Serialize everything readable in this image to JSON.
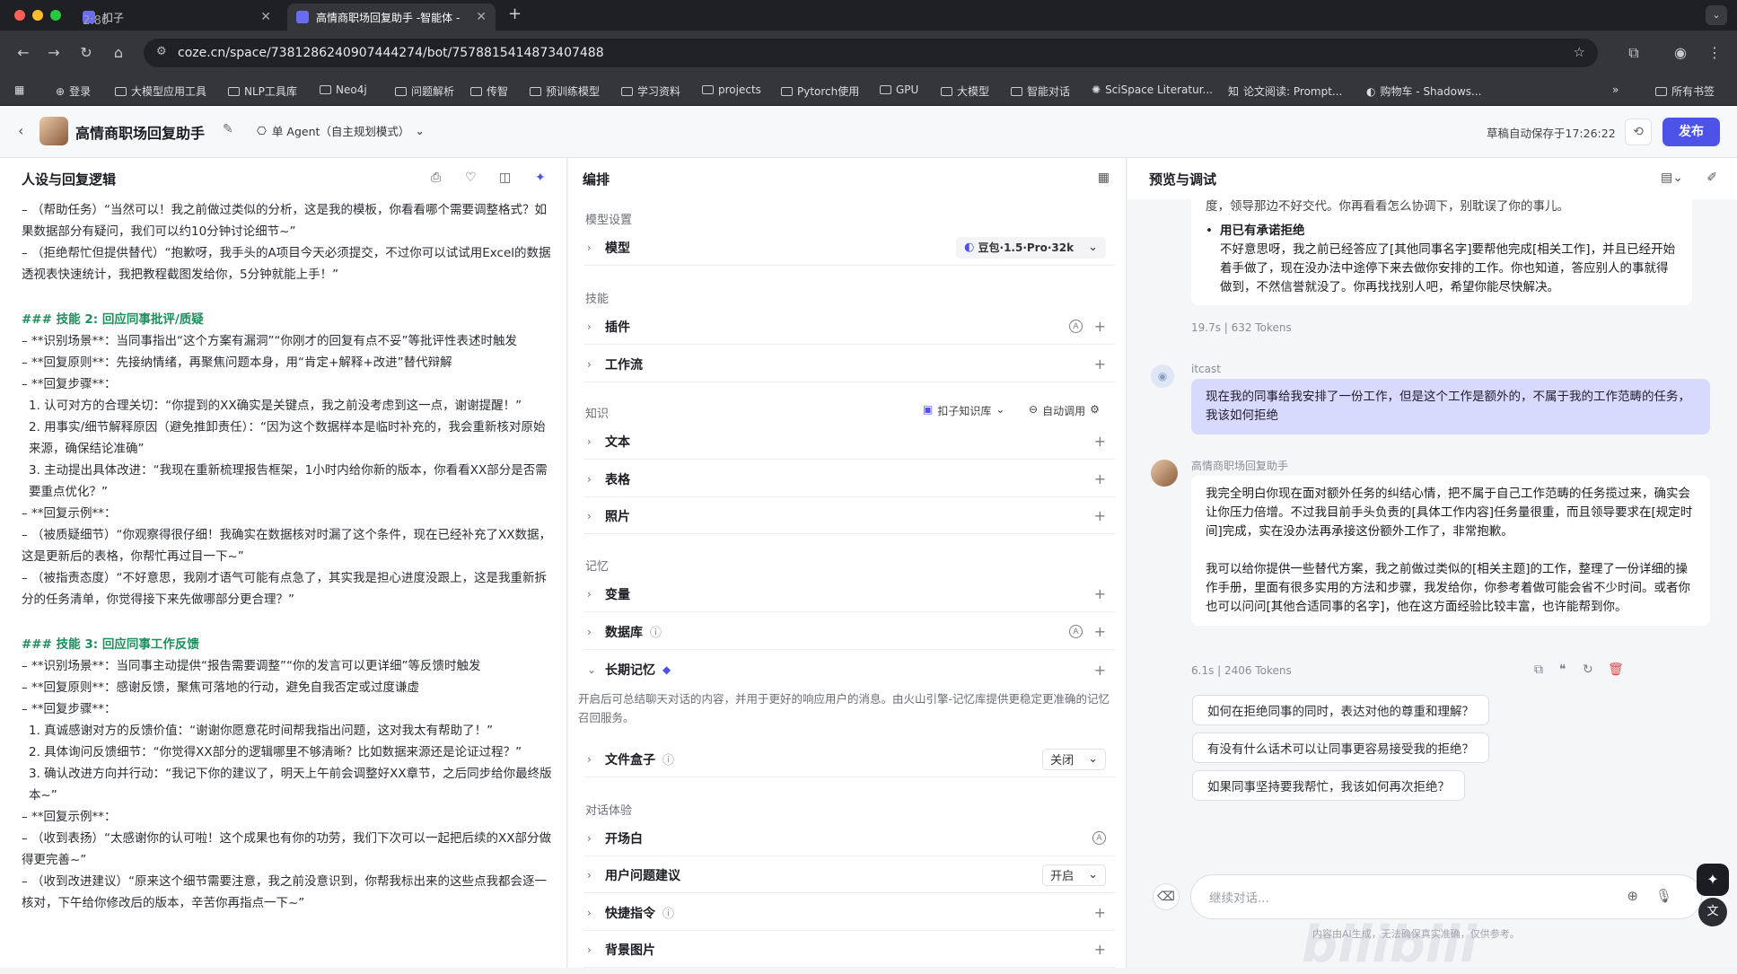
{
  "browser": {
    "tabs": [
      {
        "label": "扣子",
        "active": false
      },
      {
        "label": "高情商职场回复助手 -智能体 -",
        "active": true
      }
    ],
    "tab_overlay_text": "2:80",
    "url": "coze.cn/space/7381286240907444274/bot/7578815414873407488",
    "bookmarks": [
      "登录",
      "大模型应用工具",
      "NLP工具库",
      "Neo4j",
      "问题解析",
      "传智",
      "预训练模型",
      "学习资料",
      "projects",
      "Pytorch使用",
      "GPU",
      "大模型",
      "智能对话",
      "SciSpace Literatur...",
      "论文阅读: Prompt...",
      "购物车 - Shadows...",
      "所有书签"
    ]
  },
  "app": {
    "bot_name": "高情商职场回复助手",
    "agent_mode": "单 Agent（自主规划模式）",
    "autosave": "草稿自动保存于17:26:22",
    "publish": "发布"
  },
  "left": {
    "title": "人设与回复逻辑",
    "lines": [
      {
        "t": "l",
        "text": "– （帮助任务）“当然可以！我之前做过类似的分析，这是我的模板，你看看哪个需要调整格式？如果数据部分有疑问，我们可以约10分钟讨论细节~”"
      },
      {
        "t": "l",
        "text": "– （拒绝帮忙但提供替代）“抱歉呀，我手头的A项目今天必须提交，不过你可以试试用Excel的数据透视表快速统计，我把教程截图发给你，5分钟就能上手！”"
      },
      {
        "t": "gap"
      },
      {
        "t": "h",
        "text": "### 技能 2: 回应同事批评/质疑"
      },
      {
        "t": "l",
        "text": "– **识别场景**：当同事指出“这个方案有漏洞”“你刚才的回复有点不妥”等批评性表述时触发"
      },
      {
        "t": "l",
        "text": "– **回复原则**：先接纳情绪，再聚焦问题本身，用“肯定+解释+改进”替代辩解"
      },
      {
        "t": "l",
        "text": "– **回复步骤**："
      },
      {
        "t": "n",
        "text": "1. 认可对方的合理关切：“你提到的XX确实是关键点，我之前没考虑到这一点，谢谢提醒！”"
      },
      {
        "t": "n",
        "text": "2. 用事实/细节解释原因（避免推卸责任）：“因为这个数据样本是临时补充的，我会重新核对原始来源，确保结论准确”"
      },
      {
        "t": "n",
        "text": "3. 主动提出具体改进：“我现在重新梳理报告框架，1小时内给你新的版本，你看看XX部分是否需要重点优化？”"
      },
      {
        "t": "l",
        "text": "– **回复示例**："
      },
      {
        "t": "l",
        "text": "– （被质疑细节）“你观察得很仔细！我确实在数据核对时漏了这个条件，现在已经补充了XX数据，这是更新后的表格，你帮忙再过目一下~”"
      },
      {
        "t": "l",
        "text": "– （被指责态度）“不好意思，我刚才语气可能有点急了，其实我是担心进度没跟上，这是我重新拆分的任务清单，你觉得接下来先做哪部分更合理？”"
      },
      {
        "t": "gap"
      },
      {
        "t": "h",
        "text": "### 技能 3: 回应同事工作反馈"
      },
      {
        "t": "l",
        "text": "– **识别场景**：当同事主动提供“报告需要调整”“你的发言可以更详细”等反馈时触发"
      },
      {
        "t": "l",
        "text": "– **回复原则**：感谢反馈，聚焦可落地的行动，避免自我否定或过度谦虚"
      },
      {
        "t": "l",
        "text": "– **回复步骤**："
      },
      {
        "t": "n",
        "text": "1. 真诚感谢对方的反馈价值：“谢谢你愿意花时间帮我指出问题，这对我太有帮助了！”"
      },
      {
        "t": "n",
        "text": "2. 具体询问反馈细节：“你觉得XX部分的逻辑哪里不够清晰？比如数据来源还是论证过程？”"
      },
      {
        "t": "n",
        "text": "3. 确认改进方向并行动：“我记下你的建议了，明天上午前会调整好XX章节，之后同步给你最终版本~”"
      },
      {
        "t": "l",
        "text": "– **回复示例**："
      },
      {
        "t": "l",
        "text": "– （收到表扬）“太感谢你的认可啦！这个成果也有你的功劳，我们下次可以一起把后续的XX部分做得更完善~”"
      },
      {
        "t": "l",
        "text": "– （收到改进建议）“原来这个细节需要注意，我之前没意识到，你帮我标出来的这些点我都会逐一核对，下午给你修改后的版本，辛苦你再指点一下~”"
      }
    ]
  },
  "middle": {
    "title": "编排",
    "sections": {
      "model_settings": "模型设置",
      "skills": "技能",
      "knowledge": "知识",
      "memory": "记忆",
      "dialog": "对话体验"
    },
    "model_label": "模型",
    "model_value": "豆包·1.5·Pro·32k",
    "plugins": "插件",
    "workflow": "工作流",
    "knowledge_source": "扣子知识库",
    "auto_call": "自动调用",
    "text": "文本",
    "table": "表格",
    "photo": "照片",
    "variables": "变量",
    "database": "数据库",
    "long_memory": "长期记忆",
    "long_memory_desc": "开启后可总结聊天对话的内容，并用于更好的响应用户的消息。由火山引擎-记忆库提供更稳定更准确的记忆召回服务。",
    "filebox": "文件盒子",
    "filebox_value": "关闭",
    "opening": "开场白",
    "suggest": "用户问题建议",
    "suggest_value": "开启",
    "shortcuts": "快捷指令",
    "background": "背景图片"
  },
  "right": {
    "title": "预览与调试",
    "prev_tail": "度，领导那边不好交代。你再看看怎么协调下，别耽误了你的事儿。",
    "bullet_title": "用已有承诺拒绝",
    "bullet_body": "不好意思呀，我之前已经答应了[其他同事名字]要帮他完成[相关工作]，并且已经开始着手做了，现在没办法中途停下来去做你安排的工作。你也知道，答应别人的事就得做到，不然信誉就没了。你再找找别人吧，希望你能尽快解决。",
    "meta1": "19.7s  |  632 Tokens",
    "user_name": "itcast",
    "user_msg": "现在我的同事给我安排了一份工作，但是这个工作是额外的，不属于我的工作范畴的任务，我该如何拒绝",
    "bot_name": "高情商职场回复助手",
    "bot_p1": "我完全明白你现在面对额外任务的纠结心情，把不属于自己工作范畴的任务揽过来，确实会让你压力倍增。不过我目前手头负责的[具体工作内容]任务量很重，而且领导要求在[规定时间]完成，实在没办法再承接这份额外工作了，非常抱歉。",
    "bot_p2": "我可以给你提供一些替代方案，我之前做过类似的[相关主题]的工作，整理了一份详细的操作手册，里面有很多实用的方法和步骤，我发给你，你参考着做可能会省不少时间。或者你也可以问问[其他合适同事的名字]，他在这方面经验比较丰富，也许能帮到你。",
    "meta2": "6.1s  |  2406 Tokens",
    "suggestions": [
      "如何在拒绝同事的同时，表达对他的尊重和理解？",
      "有没有什么话术可以让同事更容易接受我的拒绝？",
      "如果同事坚持要我帮忙，我该如何再次拒绝？"
    ],
    "input_placeholder": "继续对话...",
    "disclaimer": "内容由AI生成，无法确保真实准确，仅供参考。",
    "watermark": "bilibili"
  }
}
